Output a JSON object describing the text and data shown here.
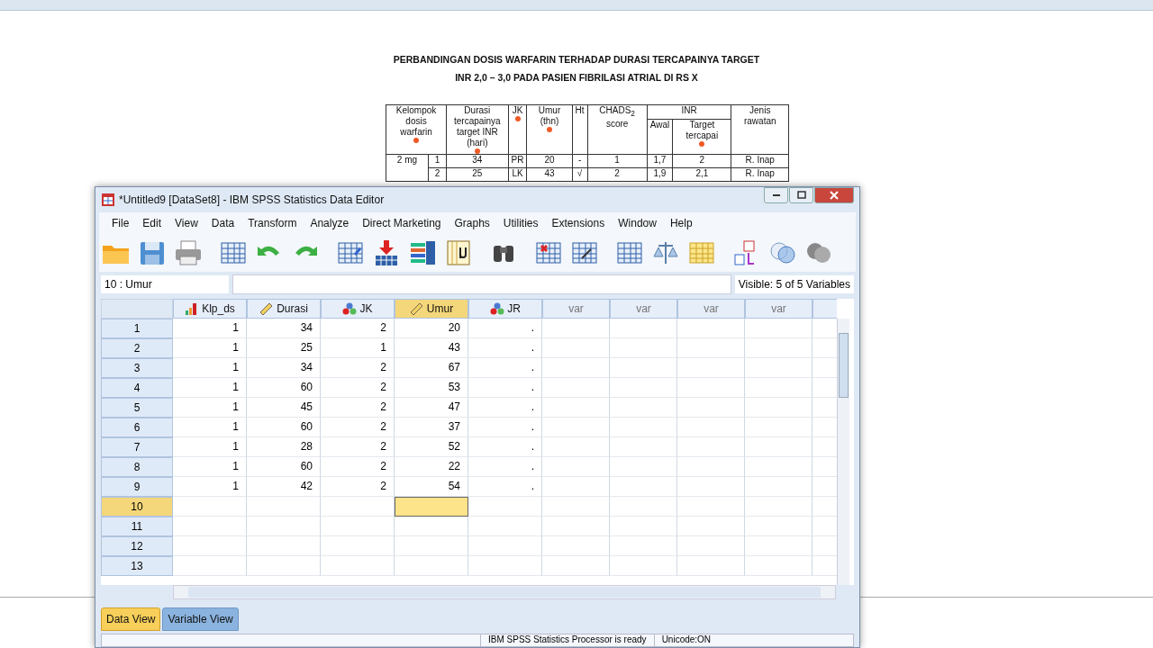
{
  "document": {
    "title": "PERBANDINGAN DOSIS WARFARIN TERHADAP DURASI TERCAPAINYA TARGET INR 2,0 – 3,0 PADA PASIEN FIBRILASI ATRIAL DI RS X",
    "headers": [
      {
        "text": "Kelompok dosis warfarin",
        "marked": true
      },
      {
        "text": "Durasi tercapainya target INR (hari)",
        "marked": true
      },
      {
        "text": "JK",
        "marked": true
      },
      {
        "text": "Umur (thn)",
        "marked": true
      },
      {
        "text": "Ht",
        "marked": false
      },
      {
        "text": "CHADS$_{2}$ score",
        "marked": false
      },
      {
        "text": "INR",
        "marked": false
      },
      {
        "text": "Jenis rawatan",
        "marked": false
      }
    ],
    "subheaders": [
      {
        "text": "Awal",
        "marked": false
      },
      {
        "text": "Target tercapai",
        "marked": true
      }
    ],
    "group": "2 mg",
    "rows": [
      [
        "1",
        "34",
        "PR",
        "20",
        "-",
        "1",
        "1,7",
        "2",
        "R. Inap"
      ],
      [
        "2",
        "25",
        "LK",
        "43",
        "√",
        "2",
        "1,9",
        "2,1",
        "R. Inap"
      ]
    ]
  },
  "window": {
    "title": "*Untitled9 [DataSet8] - IBM SPSS Statistics Data Editor"
  },
  "menu": [
    "File",
    "Edit",
    "View",
    "Data",
    "Transform",
    "Analyze",
    "Direct Marketing",
    "Graphs",
    "Utilities",
    "Extensions",
    "Window",
    "Help"
  ],
  "cell_ref": "10 : Umur",
  "visible": "Visible: 5 of 5 Variables",
  "columns": [
    {
      "name": "Klp_ds",
      "kind": "ordinal",
      "selected": false
    },
    {
      "name": "Durasi",
      "kind": "scale",
      "selected": false
    },
    {
      "name": "JK",
      "kind": "nominal",
      "selected": false
    },
    {
      "name": "Umur",
      "kind": "scale",
      "selected": true
    },
    {
      "name": "JR",
      "kind": "nominal",
      "selected": false
    },
    {
      "name": "var",
      "kind": "empty",
      "selected": false
    },
    {
      "name": "var",
      "kind": "empty",
      "selected": false
    },
    {
      "name": "var",
      "kind": "empty",
      "selected": false
    },
    {
      "name": "var",
      "kind": "empty",
      "selected": false
    }
  ],
  "rows": [
    {
      "label": "1",
      "selected": false,
      "cells": [
        "1",
        "34",
        "2",
        "20",
        "."
      ]
    },
    {
      "label": "2",
      "selected": false,
      "cells": [
        "1",
        "25",
        "1",
        "43",
        "."
      ]
    },
    {
      "label": "3",
      "selected": false,
      "cells": [
        "1",
        "34",
        "2",
        "67",
        "."
      ]
    },
    {
      "label": "4",
      "selected": false,
      "cells": [
        "1",
        "60",
        "2",
        "53",
        "."
      ]
    },
    {
      "label": "5",
      "selected": false,
      "cells": [
        "1",
        "45",
        "2",
        "47",
        "."
      ]
    },
    {
      "label": "6",
      "selected": false,
      "cells": [
        "1",
        "60",
        "2",
        "37",
        "."
      ]
    },
    {
      "label": "7",
      "selected": false,
      "cells": [
        "1",
        "28",
        "2",
        "52",
        "."
      ]
    },
    {
      "label": "8",
      "selected": false,
      "cells": [
        "1",
        "60",
        "2",
        "22",
        "."
      ]
    },
    {
      "label": "9",
      "selected": false,
      "cells": [
        "1",
        "42",
        "2",
        "54",
        "."
      ]
    },
    {
      "label": "10",
      "selected": true
    },
    {
      "label": "11",
      "selected": false
    },
    {
      "label": "12",
      "selected": false
    },
    {
      "label": "13",
      "selected": false
    }
  ],
  "tabs": [
    {
      "label": "Data View",
      "selected": true
    },
    {
      "label": "Variable View",
      "selected": false
    }
  ],
  "status": [
    "IBM SPSS Statistics Processor is ready",
    "Unicode:ON"
  ]
}
